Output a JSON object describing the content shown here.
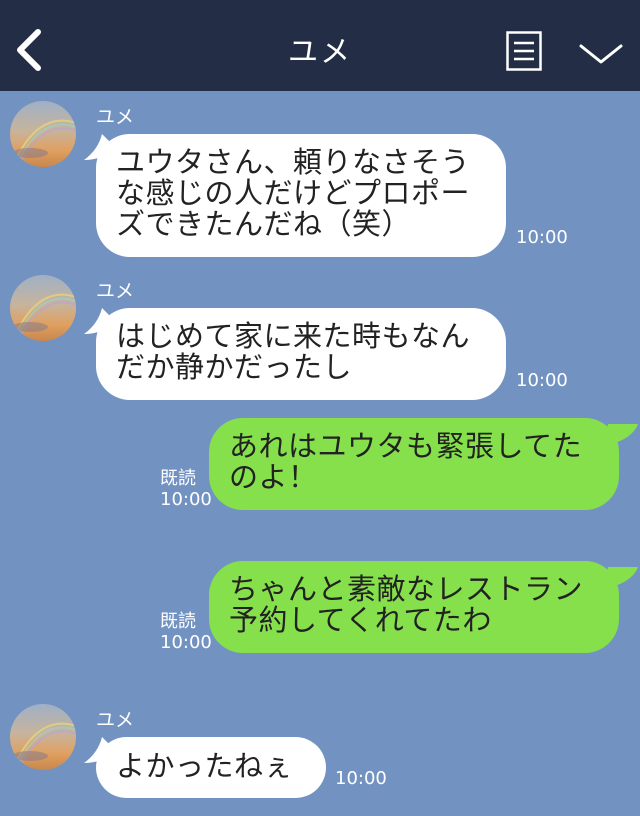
{
  "header": {
    "title": "ユメ",
    "back_icon": "chevron-left-icon",
    "menu_icon": "list-icon",
    "dropdown_icon": "chevron-down-icon",
    "background": "#232d46"
  },
  "colors": {
    "chat_background": "#7293c2",
    "incoming_bubble": "#ffffff",
    "outgoing_bubble": "#85e04b"
  },
  "messages": [
    {
      "direction": "incoming",
      "sender": "ユメ",
      "text": "ユウタさん、頼りなさそう\nな感じの人だけどプロポー\nズできたんだね（笑）",
      "time": "10:00"
    },
    {
      "direction": "incoming",
      "sender": "ユメ",
      "text": "はじめて家に来た時もなん\nだか静かだったし",
      "time": "10:00"
    },
    {
      "direction": "outgoing",
      "text": "あれはユウタも緊張してた\nのよ！",
      "read": "既読",
      "time": "10:00"
    },
    {
      "direction": "outgoing",
      "text": "ちゃんと素敵なレストラン\n予約してくれてたわ",
      "read": "既読",
      "time": "10:00"
    },
    {
      "direction": "incoming",
      "sender": "ユメ",
      "text": "よかったねぇ",
      "time": "10:00"
    }
  ]
}
